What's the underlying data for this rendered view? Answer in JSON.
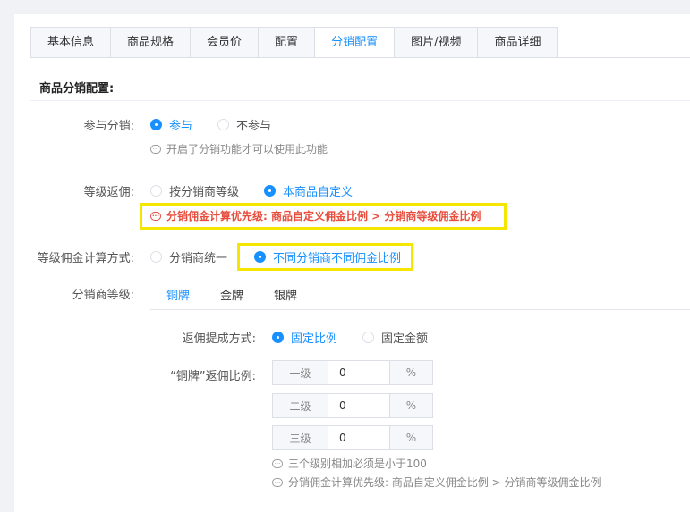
{
  "tabs": [
    {
      "label": "基本信息",
      "active": false
    },
    {
      "label": "商品规格",
      "active": false
    },
    {
      "label": "会员价",
      "active": false
    },
    {
      "label": "配置",
      "active": false
    },
    {
      "label": "分销配置",
      "active": true
    },
    {
      "label": "图片/视频",
      "active": false
    },
    {
      "label": "商品详细",
      "active": false
    }
  ],
  "section_title": "商品分销配置:",
  "participate": {
    "label": "参与分销:",
    "options": [
      {
        "label": "参与",
        "checked": true
      },
      {
        "label": "不参与",
        "checked": false
      }
    ],
    "tip": "开启了分销功能才可以使用此功能"
  },
  "level_rebate": {
    "label": "等级返佣:",
    "options": [
      {
        "label": "按分销商等级",
        "checked": false
      },
      {
        "label": "本商品自定义",
        "checked": true
      }
    ],
    "tip": "分销佣金计算优先级: 商品自定义佣金比例 > 分销商等级佣金比例"
  },
  "calc_method": {
    "label": "等级佣金计算方式:",
    "options": [
      {
        "label": "分销商统一",
        "checked": false
      },
      {
        "label": "不同分销商不同佣金比例",
        "checked": true
      }
    ]
  },
  "distributor_level": {
    "label": "分销商等级:",
    "levels": [
      {
        "label": "铜牌",
        "active": true
      },
      {
        "label": "金牌",
        "active": false
      },
      {
        "label": "银牌",
        "active": false
      }
    ]
  },
  "rebate_method": {
    "label": "返佣提成方式:",
    "options": [
      {
        "label": "固定比例",
        "checked": true
      },
      {
        "label": "固定金额",
        "checked": false
      }
    ]
  },
  "rate": {
    "label": "“铜牌”返佣比例:",
    "rows": [
      {
        "level": "一级",
        "value": "0",
        "unit": "%"
      },
      {
        "level": "二级",
        "value": "0",
        "unit": "%"
      },
      {
        "level": "三级",
        "value": "0",
        "unit": "%"
      }
    ],
    "tip1": "三个级别相加必须是小于100",
    "tip2": "分销佣金计算优先级: 商品自定义佣金比例 > 分销商等级佣金比例"
  },
  "colors": {
    "accent": "#1890ff",
    "warning": "#e74c3c",
    "highlight": "#f5e600"
  }
}
